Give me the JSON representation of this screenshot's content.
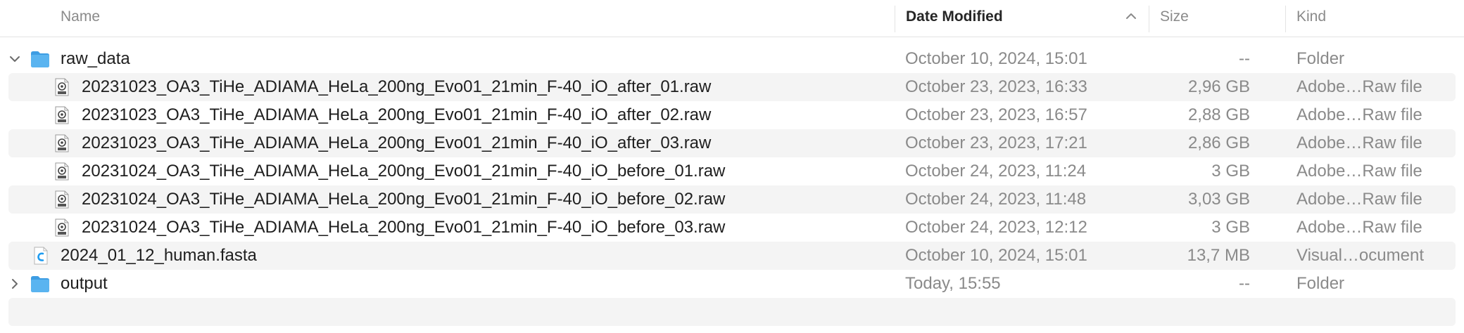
{
  "columns": {
    "name": "Name",
    "date_modified": "Date Modified",
    "size": "Size",
    "kind": "Kind"
  },
  "sort": {
    "column": "date_modified",
    "direction": "ascending-arrow-up"
  },
  "rows": [
    {
      "name": "raw_data",
      "date": "October 10, 2024, 15:01",
      "size": "--",
      "kind": "Folder",
      "type": "folder",
      "expanded": true,
      "level": 0
    },
    {
      "name": "20231023_OA3_TiHe_ADIAMA_HeLa_200ng_Evo01_21min_F-40_iO_after_01.raw",
      "date": "October 23, 2023, 16:33",
      "size": "2,96 GB",
      "kind": "Adobe…Raw file",
      "type": "raw",
      "level": 1
    },
    {
      "name": "20231023_OA3_TiHe_ADIAMA_HeLa_200ng_Evo01_21min_F-40_iO_after_02.raw",
      "date": "October 23, 2023, 16:57",
      "size": "2,88 GB",
      "kind": "Adobe…Raw file",
      "type": "raw",
      "level": 1
    },
    {
      "name": "20231023_OA3_TiHe_ADIAMA_HeLa_200ng_Evo01_21min_F-40_iO_after_03.raw",
      "date": "October 23, 2023, 17:21",
      "size": "2,86 GB",
      "kind": "Adobe…Raw file",
      "type": "raw",
      "level": 1
    },
    {
      "name": "20231024_OA3_TiHe_ADIAMA_HeLa_200ng_Evo01_21min_F-40_iO_before_01.raw",
      "date": "October 24, 2023, 11:24",
      "size": "3 GB",
      "kind": "Adobe…Raw file",
      "type": "raw",
      "level": 1
    },
    {
      "name": "20231024_OA3_TiHe_ADIAMA_HeLa_200ng_Evo01_21min_F-40_iO_before_02.raw",
      "date": "October 24, 2023, 11:48",
      "size": "3,03 GB",
      "kind": "Adobe…Raw file",
      "type": "raw",
      "level": 1
    },
    {
      "name": "20231024_OA3_TiHe_ADIAMA_HeLa_200ng_Evo01_21min_F-40_iO_before_03.raw",
      "date": "October 24, 2023, 12:12",
      "size": "3 GB",
      "kind": "Adobe…Raw file",
      "type": "raw",
      "level": 1
    },
    {
      "name": "2024_01_12_human.fasta",
      "date": "October 10, 2024, 15:01",
      "size": "13,7 MB",
      "kind": "Visual…ocument",
      "type": "code",
      "level": 0
    },
    {
      "name": "output",
      "date": "Today, 15:55",
      "size": "--",
      "kind": "Folder",
      "type": "folder",
      "expanded": false,
      "level": 0
    }
  ],
  "icons": {
    "folder": "folder-icon",
    "raw": "raw-file-icon",
    "code": "vscode-document-icon",
    "disclosure_open": "chevron-down-icon",
    "disclosure_closed": "chevron-right-icon"
  },
  "colors": {
    "folder": "#5ab4f0",
    "folder_dark": "#3d9de3",
    "alt_row": "#f4f4f4",
    "header_sorted": "#262626",
    "secondary_text": "#8a8a8a",
    "vscode_blue": "#1f9cf0"
  }
}
